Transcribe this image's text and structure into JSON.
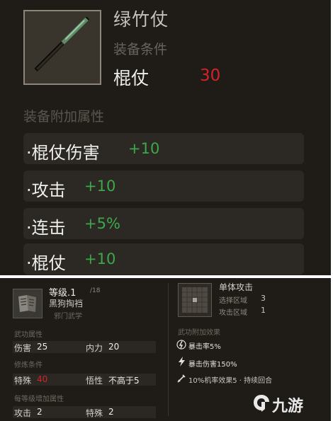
{
  "item": {
    "name": "绿竹仗",
    "requirement_title": "装备条件",
    "requirement_type": "棍仗",
    "requirement_value": "30",
    "bonus_title": "装备附加属性",
    "bonuses": [
      {
        "label": "·棍仗伤害",
        "value": "+10"
      },
      {
        "label": "·攻击",
        "value": "+10"
      },
      {
        "label": "·连击",
        "value": "+5%"
      },
      {
        "label": "·棍仗",
        "value": "+10"
      }
    ]
  },
  "skill": {
    "level_label": "等级.1",
    "level_max": "/18",
    "name": "黑狗掏裆",
    "school": "邪门武学",
    "attr_title": "武功属性",
    "damage_label": "伤害",
    "damage_value": "25",
    "inner_label": "内力",
    "inner_value": "20",
    "train_title": "修炼条件",
    "special_label": "特殊",
    "special_value": "40",
    "insight_label": "悟性",
    "insight_value": "不高于5",
    "level_bonus_title": "每等级增加属性",
    "atk_label": "攻击",
    "atk_value": "2",
    "special2_label": "特殊",
    "special2_value": "2",
    "attack_type": "单体攻击",
    "select_label": "选择区域",
    "select_value": "3",
    "area_label": "攻击区域",
    "area_value": "1",
    "effects_title": "武功附加效果",
    "effects": [
      "暴击率5%",
      "暴击伤害150%",
      "10%机率效果5 · 持续回合"
    ]
  },
  "watermark": "九游",
  "colors": {
    "bg": "#1f1c17",
    "green": "#3da84a",
    "red": "#d2232a",
    "text": "#efefed"
  }
}
